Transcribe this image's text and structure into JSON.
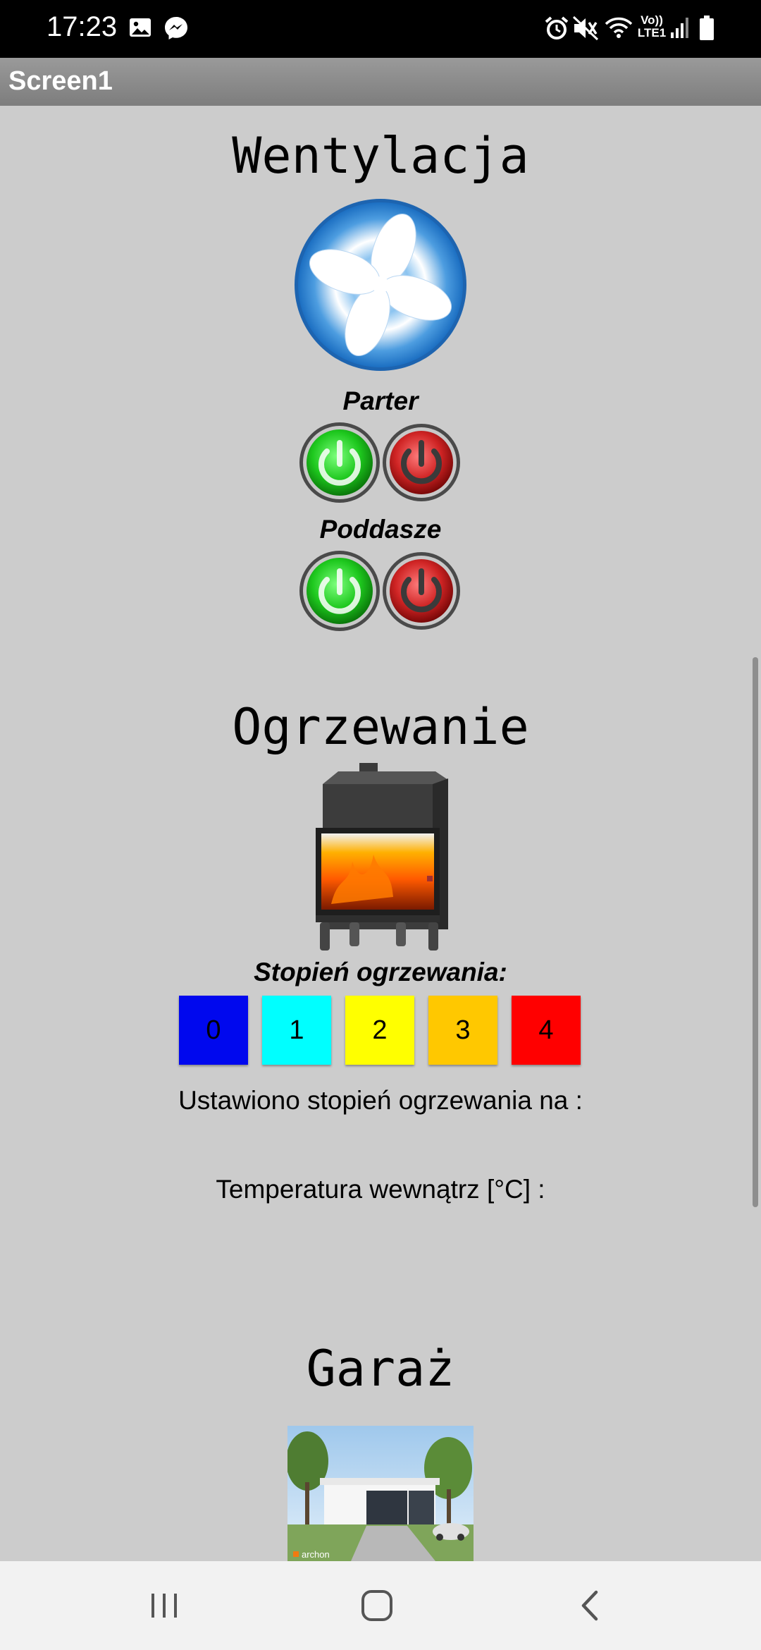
{
  "status_bar": {
    "time": "17:23",
    "net_label": "Vo)) LTE1",
    "icons": [
      "gallery-icon",
      "messenger-icon",
      "alarm-icon",
      "mute-icon",
      "wifi-icon",
      "signal-icon",
      "battery-icon"
    ]
  },
  "app": {
    "title": "Screen1"
  },
  "ventilation": {
    "heading": "Wentylacja",
    "floor1_label": "Parter",
    "floor2_label": "Poddasze"
  },
  "heating": {
    "heading": "Ogrzewanie",
    "level_label": "Stopień ogrzewania:",
    "levels": [
      {
        "label": "0",
        "color": "#0008ee"
      },
      {
        "label": "1",
        "color": "#00ffff"
      },
      {
        "label": "2",
        "color": "#ffff00"
      },
      {
        "label": "3",
        "color": "#ffc800"
      },
      {
        "label": "4",
        "color": "#ff0000"
      }
    ],
    "set_level_text": "Ustawiono stopień ogrzewania na :",
    "temperature_text": "Temperatura wewnątrz [°C]  :"
  },
  "garage": {
    "heading": "Garaż",
    "image_watermark": "archon"
  },
  "colors": {
    "background": "#cccccc",
    "on_button": "#22c822",
    "off_button": "#d42a2a"
  }
}
